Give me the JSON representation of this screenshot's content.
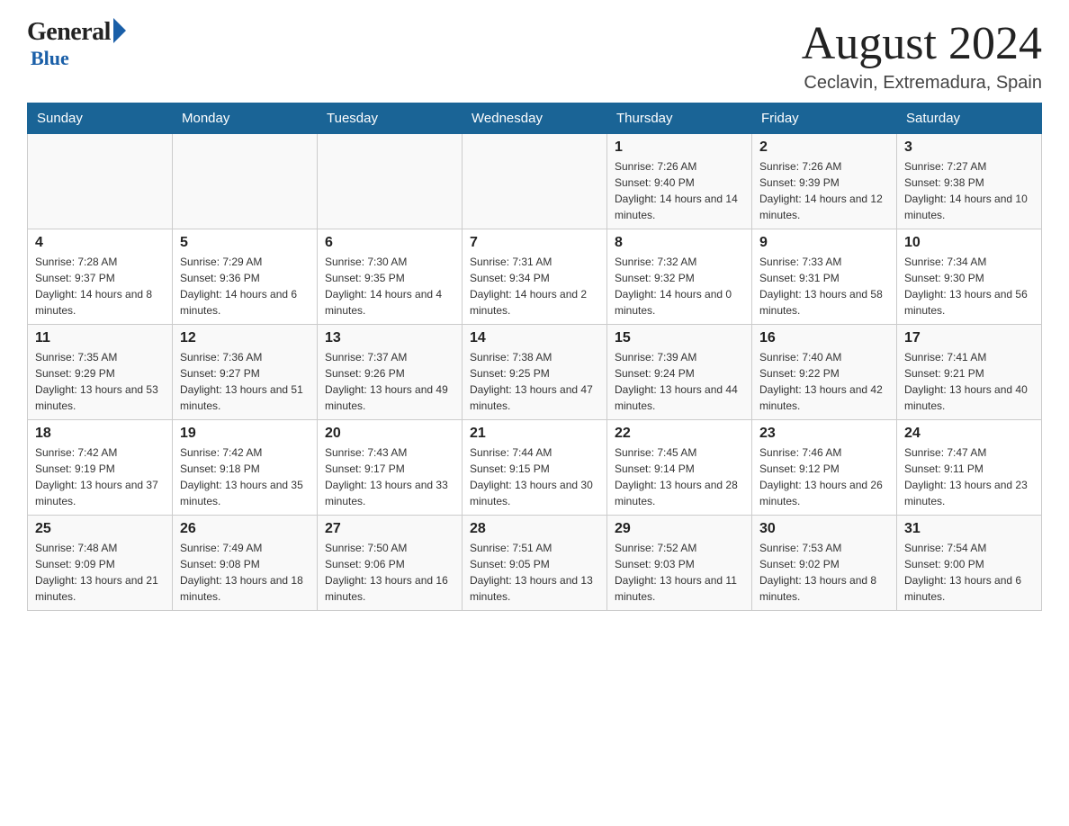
{
  "header": {
    "logo_general": "General",
    "logo_blue": "Blue",
    "month_title": "August 2024",
    "location": "Ceclavin, Extremadura, Spain"
  },
  "calendar": {
    "days_of_week": [
      "Sunday",
      "Monday",
      "Tuesday",
      "Wednesday",
      "Thursday",
      "Friday",
      "Saturday"
    ],
    "weeks": [
      [
        {
          "day": "",
          "info": ""
        },
        {
          "day": "",
          "info": ""
        },
        {
          "day": "",
          "info": ""
        },
        {
          "day": "",
          "info": ""
        },
        {
          "day": "1",
          "info": "Sunrise: 7:26 AM\nSunset: 9:40 PM\nDaylight: 14 hours and 14 minutes."
        },
        {
          "day": "2",
          "info": "Sunrise: 7:26 AM\nSunset: 9:39 PM\nDaylight: 14 hours and 12 minutes."
        },
        {
          "day": "3",
          "info": "Sunrise: 7:27 AM\nSunset: 9:38 PM\nDaylight: 14 hours and 10 minutes."
        }
      ],
      [
        {
          "day": "4",
          "info": "Sunrise: 7:28 AM\nSunset: 9:37 PM\nDaylight: 14 hours and 8 minutes."
        },
        {
          "day": "5",
          "info": "Sunrise: 7:29 AM\nSunset: 9:36 PM\nDaylight: 14 hours and 6 minutes."
        },
        {
          "day": "6",
          "info": "Sunrise: 7:30 AM\nSunset: 9:35 PM\nDaylight: 14 hours and 4 minutes."
        },
        {
          "day": "7",
          "info": "Sunrise: 7:31 AM\nSunset: 9:34 PM\nDaylight: 14 hours and 2 minutes."
        },
        {
          "day": "8",
          "info": "Sunrise: 7:32 AM\nSunset: 9:32 PM\nDaylight: 14 hours and 0 minutes."
        },
        {
          "day": "9",
          "info": "Sunrise: 7:33 AM\nSunset: 9:31 PM\nDaylight: 13 hours and 58 minutes."
        },
        {
          "day": "10",
          "info": "Sunrise: 7:34 AM\nSunset: 9:30 PM\nDaylight: 13 hours and 56 minutes."
        }
      ],
      [
        {
          "day": "11",
          "info": "Sunrise: 7:35 AM\nSunset: 9:29 PM\nDaylight: 13 hours and 53 minutes."
        },
        {
          "day": "12",
          "info": "Sunrise: 7:36 AM\nSunset: 9:27 PM\nDaylight: 13 hours and 51 minutes."
        },
        {
          "day": "13",
          "info": "Sunrise: 7:37 AM\nSunset: 9:26 PM\nDaylight: 13 hours and 49 minutes."
        },
        {
          "day": "14",
          "info": "Sunrise: 7:38 AM\nSunset: 9:25 PM\nDaylight: 13 hours and 47 minutes."
        },
        {
          "day": "15",
          "info": "Sunrise: 7:39 AM\nSunset: 9:24 PM\nDaylight: 13 hours and 44 minutes."
        },
        {
          "day": "16",
          "info": "Sunrise: 7:40 AM\nSunset: 9:22 PM\nDaylight: 13 hours and 42 minutes."
        },
        {
          "day": "17",
          "info": "Sunrise: 7:41 AM\nSunset: 9:21 PM\nDaylight: 13 hours and 40 minutes."
        }
      ],
      [
        {
          "day": "18",
          "info": "Sunrise: 7:42 AM\nSunset: 9:19 PM\nDaylight: 13 hours and 37 minutes."
        },
        {
          "day": "19",
          "info": "Sunrise: 7:42 AM\nSunset: 9:18 PM\nDaylight: 13 hours and 35 minutes."
        },
        {
          "day": "20",
          "info": "Sunrise: 7:43 AM\nSunset: 9:17 PM\nDaylight: 13 hours and 33 minutes."
        },
        {
          "day": "21",
          "info": "Sunrise: 7:44 AM\nSunset: 9:15 PM\nDaylight: 13 hours and 30 minutes."
        },
        {
          "day": "22",
          "info": "Sunrise: 7:45 AM\nSunset: 9:14 PM\nDaylight: 13 hours and 28 minutes."
        },
        {
          "day": "23",
          "info": "Sunrise: 7:46 AM\nSunset: 9:12 PM\nDaylight: 13 hours and 26 minutes."
        },
        {
          "day": "24",
          "info": "Sunrise: 7:47 AM\nSunset: 9:11 PM\nDaylight: 13 hours and 23 minutes."
        }
      ],
      [
        {
          "day": "25",
          "info": "Sunrise: 7:48 AM\nSunset: 9:09 PM\nDaylight: 13 hours and 21 minutes."
        },
        {
          "day": "26",
          "info": "Sunrise: 7:49 AM\nSunset: 9:08 PM\nDaylight: 13 hours and 18 minutes."
        },
        {
          "day": "27",
          "info": "Sunrise: 7:50 AM\nSunset: 9:06 PM\nDaylight: 13 hours and 16 minutes."
        },
        {
          "day": "28",
          "info": "Sunrise: 7:51 AM\nSunset: 9:05 PM\nDaylight: 13 hours and 13 minutes."
        },
        {
          "day": "29",
          "info": "Sunrise: 7:52 AM\nSunset: 9:03 PM\nDaylight: 13 hours and 11 minutes."
        },
        {
          "day": "30",
          "info": "Sunrise: 7:53 AM\nSunset: 9:02 PM\nDaylight: 13 hours and 8 minutes."
        },
        {
          "day": "31",
          "info": "Sunrise: 7:54 AM\nSunset: 9:00 PM\nDaylight: 13 hours and 6 minutes."
        }
      ]
    ]
  }
}
